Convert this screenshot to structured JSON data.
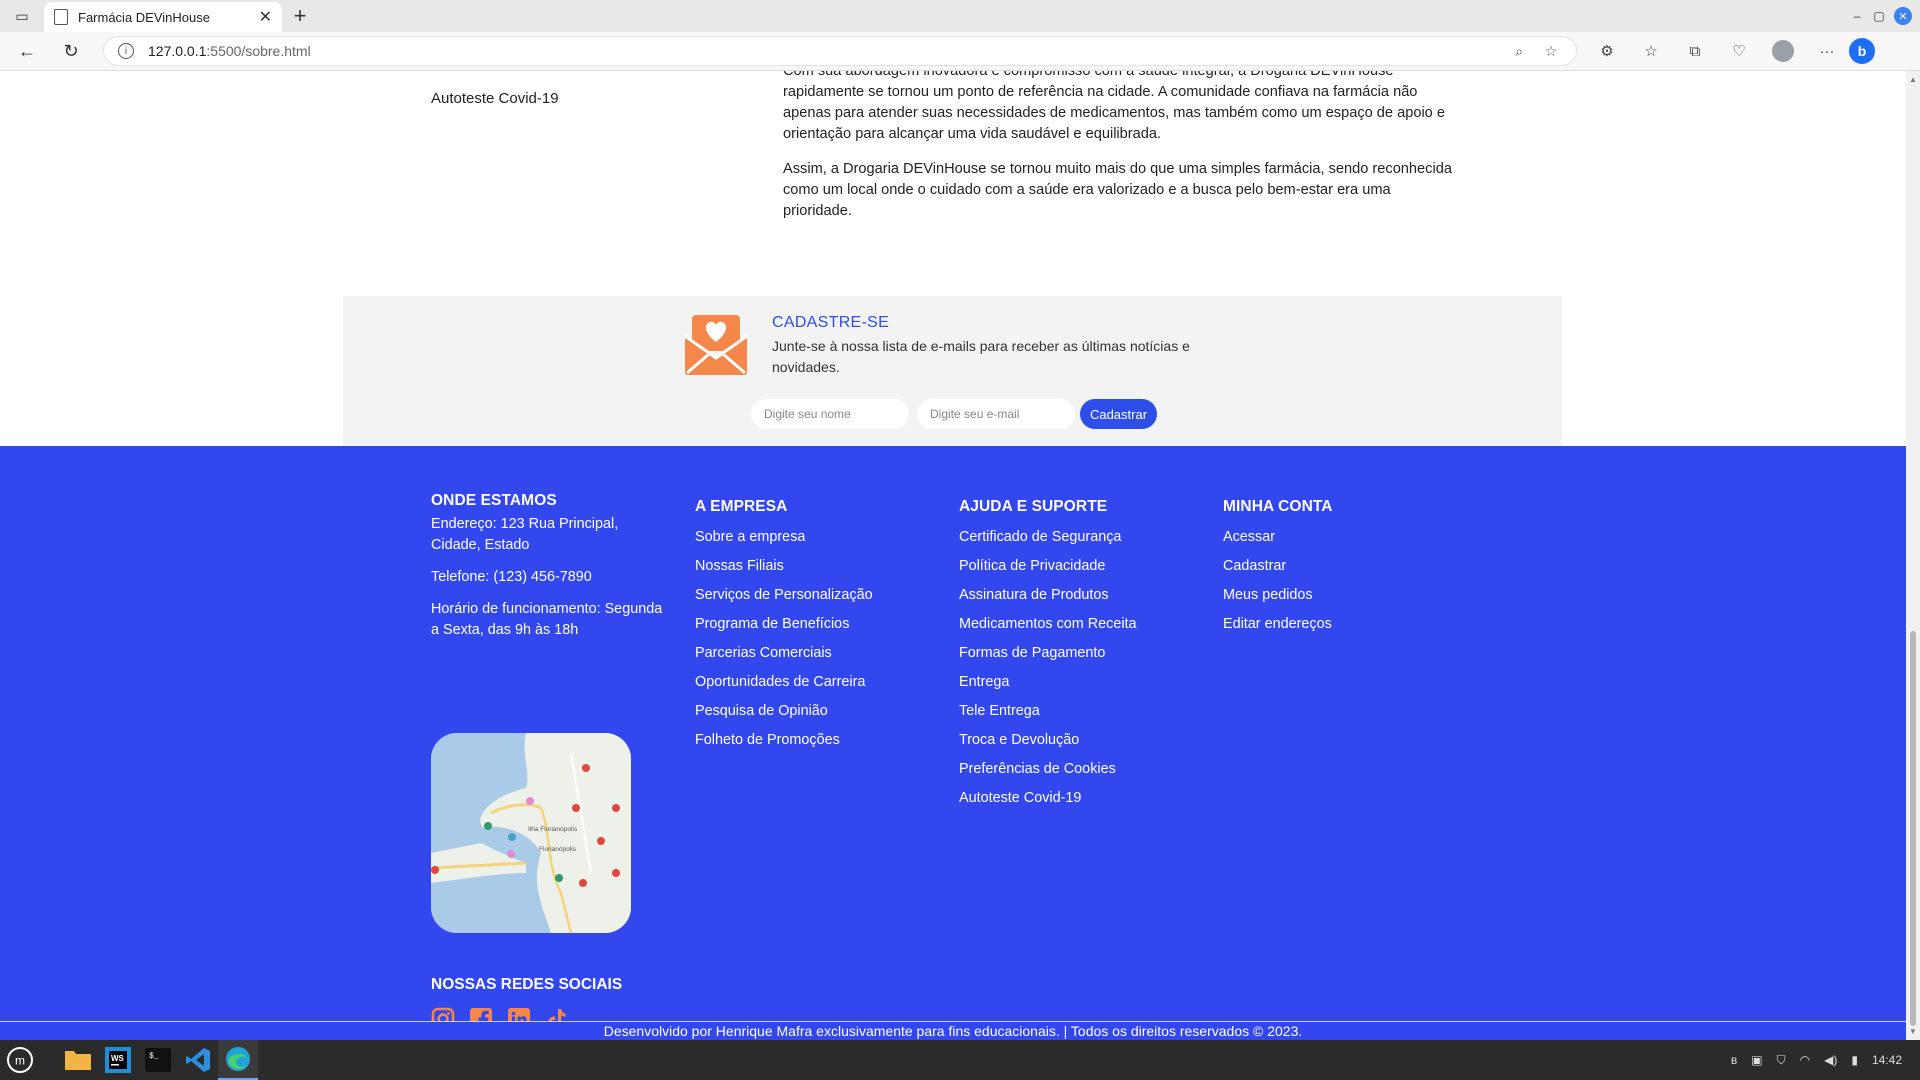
{
  "browser": {
    "tab_title": "Farmácia DEVinHouse",
    "url_host": "127.0.0.1",
    "url_path": ":5500/sobre.html"
  },
  "page": {
    "side_link": "Autoteste Covid-19",
    "about_paragraphs": [
      "Com sua abordagem inovadora e compromisso com a saúde integral, a Drogaria DEVinHouse rapidamente se tornou um ponto de referência na cidade. A comunidade confiava na farmácia não apenas para atender suas necessidades de medicamentos, mas também como um espaço de apoio e orientação para alcançar uma vida saudável e equilibrada.",
      "Assim, a Drogaria DEVinHouse se tornou muito mais do que uma simples farmácia, sendo reconhecida como um local onde o cuidado com a saúde era valorizado e a busca pelo bem-estar era uma prioridade."
    ]
  },
  "newsletter": {
    "title": "CADASTRE-SE",
    "description": "Junte-se à nossa lista de e-mails para receber as últimas notícias e novidades.",
    "name_placeholder": "Digite seu nome",
    "email_placeholder": "Digite seu e-mail",
    "submit_label": "Cadastrar"
  },
  "footer": {
    "location": {
      "title": "ONDE ESTAMOS",
      "address": "Endereço: 123 Rua Principal, Cidade, Estado",
      "phone": "Telefone: (123) 456-7890",
      "hours": "Horário de funcionamento: Segunda a Sexta, das 9h às 18h"
    },
    "company": {
      "title": "A EMPRESA",
      "links": [
        "Sobre a empresa",
        "Nossas Filiais",
        "Serviços de Personalização",
        "Programa de Benefícios",
        "Parcerias Comerciais",
        "Oportunidades de Carreira",
        "Pesquisa de Opinião",
        "Folheto de Promoções"
      ]
    },
    "support": {
      "title": "AJUDA E SUPORTE",
      "links": [
        "Certificado de Segurança",
        "Política de Privacidade",
        "Assinatura de Produtos",
        "Medicamentos com Receita",
        "Formas de Pagamento",
        "Entrega",
        "Tele Entrega",
        "Troca e Devolução",
        "Preferências de Cookies",
        "Autoteste Covid-19"
      ]
    },
    "account": {
      "title": "MINHA CONTA",
      "links": [
        "Acessar",
        "Cadastrar",
        "Meus pedidos",
        "Editar endereços"
      ]
    },
    "social_title": "NOSSAS REDES SOCIAIS",
    "social_icons": [
      "instagram-icon",
      "facebook-icon",
      "linkedin-icon",
      "tiktok-icon"
    ],
    "credits": "Desenvolvido por Henrique Mafra exclusivamente para fins educacionais. | Todos os direitos reservados © 2023."
  },
  "map_labels": [
    "Ilha Florianópolis",
    "Florianópolis"
  ],
  "taskbar": {
    "clock": "14:42"
  },
  "colors": {
    "footer_bg": "#3347ef",
    "accent_blue": "#2d4ee8",
    "social_orange": "#f5874a",
    "newsletter_bg": "#f3f3f3"
  }
}
